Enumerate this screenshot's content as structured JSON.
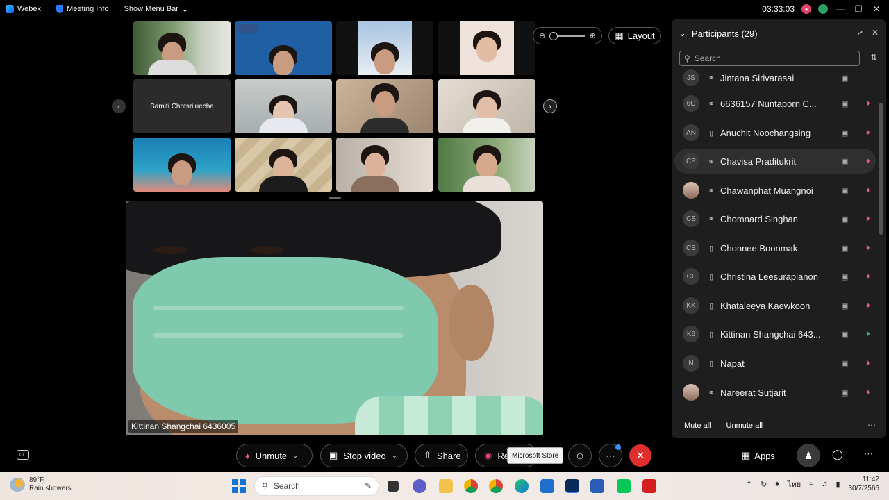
{
  "topbar": {
    "app_name": "Webex",
    "meeting_info": "Meeting Info",
    "show_menu_bar": "Show Menu Bar",
    "timer": "03:33:03"
  },
  "grid": {
    "name_only_tile": "Samiti Chotsriluecha"
  },
  "main_video": {
    "name_label": "Kittinan Shangchai 6436005"
  },
  "view": {
    "layout_label": "Layout"
  },
  "participants": {
    "title": "Participants (29)",
    "search_placeholder": "Search",
    "rows": [
      {
        "initials": "JS",
        "name": "Jintana Sirivarasai",
        "device": "headset",
        "mic": "muted"
      },
      {
        "initials": "6C",
        "name": "6636157 Nuntaporn C...",
        "device": "headset",
        "mic": "muted"
      },
      {
        "initials": "AN",
        "name": "Anuchit Noochangsing",
        "device": "phone",
        "mic": "muted"
      },
      {
        "initials": "CP",
        "name": "Chavisa Praditukrit",
        "device": "headset",
        "mic": "muted"
      },
      {
        "initials": "",
        "name": "Chawanphat Muangnoi",
        "device": "headset",
        "mic": "muted"
      },
      {
        "initials": "CS",
        "name": "Chomnard Singhan",
        "device": "headset",
        "mic": "muted"
      },
      {
        "initials": "CB",
        "name": "Chonnee Boonmak",
        "device": "phone",
        "mic": "muted"
      },
      {
        "initials": "CL",
        "name": "Christina Leesuraplanon",
        "device": "phone",
        "mic": "muted"
      },
      {
        "initials": "KK",
        "name": "Khataleeya Kaewkoon",
        "device": "phone",
        "mic": "muted"
      },
      {
        "initials": "K6",
        "name": "Kittinan Shangchai 643...",
        "device": "phone",
        "mic": "unmuted"
      },
      {
        "initials": "N",
        "name": "Napat",
        "device": "phone",
        "mic": "muted"
      },
      {
        "initials": "",
        "name": "Nareerat Sutjarit",
        "device": "headset",
        "mic": "muted"
      }
    ],
    "mute_all": "Mute all",
    "unmute_all": "Unmute all"
  },
  "controls": {
    "unmute": "Unmute",
    "stop_video": "Stop video",
    "share": "Share",
    "record_partial": "Re",
    "tooltip": "Microsoft Store",
    "apps": "Apps"
  },
  "taskbar": {
    "temperature": "89°F",
    "weather": "Rain showers",
    "search": "Search",
    "language": "ไทย",
    "time": "11:42",
    "date": "30/7/2566"
  },
  "colors": {
    "accent_red": "#e02d2d",
    "muted_mic": "#e85a7a",
    "unmuted_mic": "#2fb36b",
    "record": "#e3426b"
  }
}
